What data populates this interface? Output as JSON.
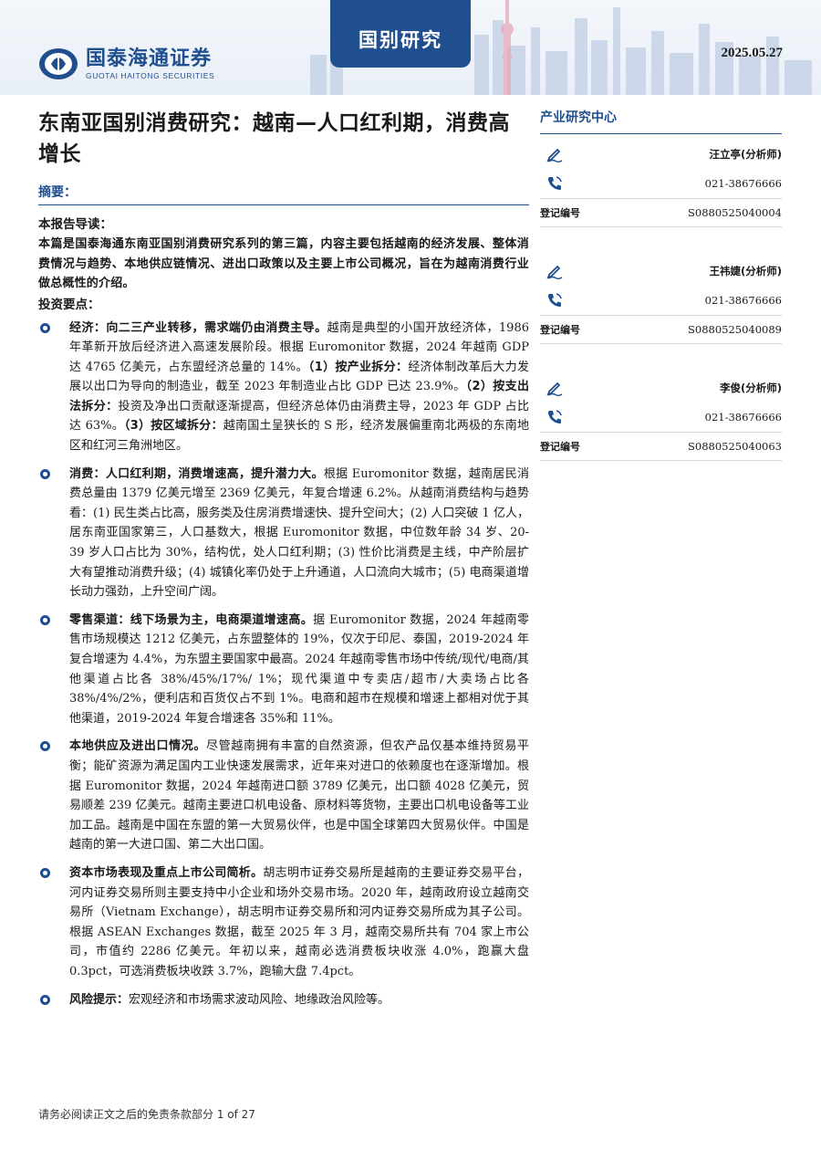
{
  "header": {
    "brand_cn": "国泰海通证券",
    "brand_en": "GUOTAI HAITONG SECURITIES",
    "tag": "国别研究",
    "date": "2025.05.27"
  },
  "title": "东南亚国别消费研究：越南—人口红利期，消费高增长",
  "abstract_label": "摘要：",
  "guide": {
    "heading": "本报告导读：",
    "text": "本篇是国泰海通东南亚国别消费研究系列的第三篇，内容主要包括越南的经济发展、整体消费情况与趋势、本地供应链情况、进出口政策以及主要上市公司概况，旨在为越南消费行业做总概性的介绍。"
  },
  "points_heading": "投资要点：",
  "points": [
    {
      "lead": "经济：向二三产业转移，需求端仍由消费主导。",
      "text": "越南是典型的小国开放经济体，1986 年革新开放后经济进入高速发展阶段。根据 Euromonitor 数据，2024 年越南 GDP 达 4765 亿美元，占东盟经济总量的 14%。",
      "s1_lead": "（1）按产业拆分：",
      "s1": "经济体制改革后大力发展以出口为导向的制造业，截至 2023 年制造业占比 GDP 已达 23.9%。",
      "s2_lead": "（2）按支出法拆分：",
      "s2": "投资及净出口贡献逐渐提高，但经济总体仍由消费主导，2023 年 GDP 占比达 63%。",
      "s3_lead": "（3）按区域拆分：",
      "s3": "越南国土呈狭长的 S 形，经济发展偏重南北两极的东南地区和红河三角洲地区。"
    },
    {
      "lead": "消费：人口红利期，消费增速高，提升潜力大。",
      "text": "根据 Euromonitor 数据，越南居民消费总量由 1379 亿美元增至 2369 亿美元，年复合增速 6.2%。从越南消费结构与趋势看：(1) 民生类占比高，服务类及住房消费增速快、提升空间大；(2) 人口突破 1 亿人，居东南亚国家第三，人口基数大，根据 Euromonitor 数据，中位数年龄 34 岁、20-39 岁人口占比为 30%，结构优，处人口红利期；(3) 性价比消费是主线，中产阶层扩大有望推动消费升级；(4) 城镇化率仍处于上升通道，人口流向大城市；(5) 电商渠道增长动力强劲，上升空间广阔。"
    },
    {
      "lead": "零售渠道：线下场景为主，电商渠道增速高。",
      "text": "据 Euromonitor 数据，2024 年越南零售市场规模达 1212 亿美元，占东盟整体的 19%，仅次于印尼、泰国，2019-2024 年复合增速为 4.4%，为东盟主要国家中最高。2024 年越南零售市场中传统/现代/电商/其他渠道占比各 38%/45%/17%/ 1%；现代渠道中专卖店/超市/大卖场占比各 38%/4%/2%，便利店和百货仅占不到 1%。电商和超市在规模和增速上都相对优于其他渠道，2019-2024 年复合增速各 35%和 11%。"
    },
    {
      "lead": "本地供应及进出口情况。",
      "text": "尽管越南拥有丰富的自然资源，但农产品仅基本维持贸易平衡；能矿资源为满足国内工业快速发展需求，近年来对进口的依赖度也在逐渐增加。根据 Euromonitor 数据，2024 年越南进口额 3789 亿美元，出口额 4028 亿美元，贸易顺差 239 亿美元。越南主要进口机电设备、原材料等货物，主要出口机电设备等工业加工品。越南是中国在东盟的第一大贸易伙伴，也是中国全球第四大贸易伙伴。中国是越南的第一大进口国、第二大出口国。"
    },
    {
      "lead": "资本市场表现及重点上市公司简析。",
      "text": "胡志明市证券交易所是越南的主要证券交易平台，河内证券交易所则主要支持中小企业和场外交易市场。2020 年，越南政府设立越南交易所（Vietnam Exchange），胡志明市证券交易所和河内证券交易所成为其子公司。根据 ASEAN Exchanges 数据，截至 2025 年 3 月，越南交易所共有 704 家上市公司，市值约 2286 亿美元。年初以来，越南必选消费板块收涨 4.0%，跑赢大盘 0.3pct，可选消费板块收跌 3.7%，跑输大盘 7.4pct。"
    },
    {
      "lead": "风险提示：",
      "text": "宏观经济和市场需求波动风险、地缘政治风险等。"
    }
  ],
  "footer": "请务必阅读正文之后的免责条款部分 1 of 27",
  "sidebar": {
    "center_title": "产业研究中心",
    "reg_label": "登记编号",
    "analysts": [
      {
        "name": "汪立亭(分析师)",
        "phone": "021-38676666",
        "reg": "S0880525040004"
      },
      {
        "name": "王祎婕(分析师)",
        "phone": "021-38676666",
        "reg": "S0880525040089"
      },
      {
        "name": "李俊(分析师)",
        "phone": "021-38676666",
        "reg": "S0880525040063"
      }
    ]
  },
  "colors": {
    "brand": "#1f4f8f",
    "text": "#1a1a1a"
  },
  "icons": {
    "write": "pen-icon",
    "phone": "phone-icon",
    "bullet": "ring-bullet-icon",
    "logo": "logo-mark-icon"
  }
}
